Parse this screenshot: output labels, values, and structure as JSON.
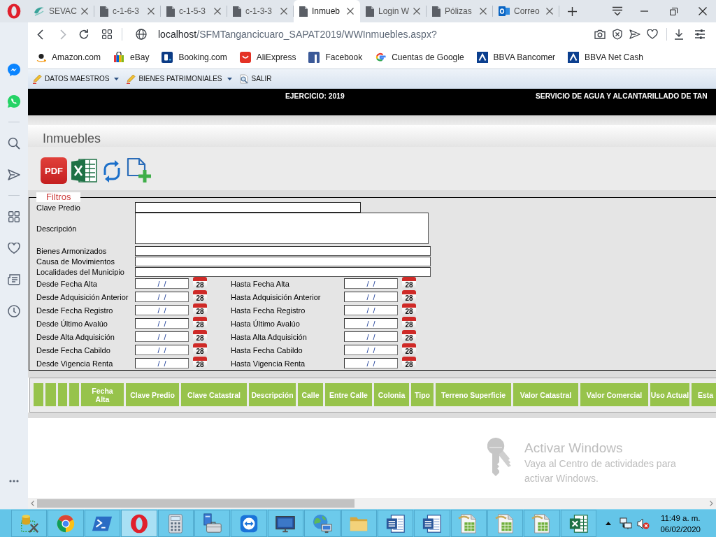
{
  "browser": {
    "tabs": [
      {
        "title": "SEVAC",
        "selected": false
      },
      {
        "title": "c-1-6-3",
        "selected": false
      },
      {
        "title": "c-1-5-3",
        "selected": false
      },
      {
        "title": "c-1-3-3",
        "selected": false
      },
      {
        "title": "Inmueb",
        "selected": true
      },
      {
        "title": "Login W",
        "selected": false
      },
      {
        "title": "Pólizas",
        "selected": false
      },
      {
        "title": "Correo",
        "selected": false
      }
    ],
    "address": {
      "host": "localhost",
      "path": "/SFMTangancicuaro_SAPAT2019/WWInmuebles.aspx?"
    },
    "bookmarks": [
      "Amazon.com",
      "eBay",
      "Booking.com",
      "AliExpress",
      "Facebook",
      "Cuentas de Google",
      "BBVA Bancomer",
      "BBVA Net Cash"
    ]
  },
  "menu": [
    {
      "label": "DATOS MAESTROS",
      "kind": "submenu"
    },
    {
      "label": "BIENES PATRIMONIALES",
      "kind": "submenu"
    },
    {
      "label": "SALIR",
      "kind": "command"
    }
  ],
  "header": {
    "exercise": "EJERCICIO: 2019",
    "organization": "SERVICIO DE AGUA Y ALCANTARILLADO DE TAN"
  },
  "page_title": "Inmuebles",
  "toolbar": [
    {
      "kind": "pdf",
      "label": "PDF"
    },
    {
      "kind": "spreadsheet"
    },
    {
      "kind": "refresh"
    },
    {
      "kind": "add"
    }
  ],
  "filters": {
    "legend": "Filtros",
    "fields": [
      {
        "label": "Clave Predio",
        "kind": "short"
      },
      {
        "label": "Descripción",
        "kind": "multiline"
      },
      {
        "label": "Bienes Armonizados",
        "kind": "long"
      },
      {
        "label": "Causa de Movimientos",
        "kind": "long"
      },
      {
        "label": "Localidades del Municipio",
        "kind": "long"
      }
    ],
    "date_ranges": [
      {
        "from": {
          "label": "Desde Fecha Alta",
          "value": "/  /",
          "calendar": "28"
        },
        "to": {
          "label": "Hasta Fecha Alta",
          "value": "/  /",
          "calendar": "28"
        }
      },
      {
        "from": {
          "label": "Desde Adquisición Anterior",
          "value": "/  /",
          "calendar": "28"
        },
        "to": {
          "label": "Hasta Adquisición Anterior",
          "value": "/  /",
          "calendar": "28"
        }
      },
      {
        "from": {
          "label": "Desde Fecha Registro",
          "value": "/  /",
          "calendar": "28"
        },
        "to": {
          "label": "Hasta Fecha Registro",
          "value": "/  /",
          "calendar": "28"
        }
      },
      {
        "from": {
          "label": "Desde Último Avalúo",
          "value": "/  /",
          "calendar": "28"
        },
        "to": {
          "label": "Hasta Último Avalúo",
          "value": "/  /",
          "calendar": "28"
        }
      },
      {
        "from": {
          "label": "Desde Alta Adquisición",
          "value": "/  /",
          "calendar": "28"
        },
        "to": {
          "label": "Hasta Alta Adquisición",
          "value": "/  /",
          "calendar": "28"
        }
      },
      {
        "from": {
          "label": "Desde Fecha Cabildo",
          "value": "/  /",
          "calendar": "28"
        },
        "to": {
          "label": "Hasta Fecha Cabildo",
          "value": "/  /",
          "calendar": "28"
        }
      },
      {
        "from": {
          "label": "Desde Vigencia Renta",
          "value": "/  /",
          "calendar": "28"
        },
        "to": {
          "label": "Hasta Vigencia Renta",
          "value": "/  /",
          "calendar": "28"
        }
      }
    ]
  },
  "grid": {
    "columns": [
      {
        "kind": "blank"
      },
      {
        "kind": "blank"
      },
      {
        "kind": "blank"
      },
      {
        "kind": "blank"
      },
      {
        "kind": "text",
        "label": "Fecha Alta"
      },
      {
        "kind": "text",
        "label": "Clave Predio"
      },
      {
        "kind": "text",
        "label": "Clave Catastral"
      },
      {
        "kind": "text",
        "label": "Descripción"
      },
      {
        "kind": "text",
        "label": "Calle"
      },
      {
        "kind": "text",
        "label": "Entre Calle"
      },
      {
        "kind": "text",
        "label": "Colonia"
      },
      {
        "kind": "text",
        "label": "Tipo"
      },
      {
        "kind": "text",
        "label": "Terreno Superficie"
      },
      {
        "kind": "text",
        "label": "Valor Catastral"
      },
      {
        "kind": "text",
        "label": "Valor Comercial"
      },
      {
        "kind": "text",
        "label": "Uso Actual"
      },
      {
        "kind": "text",
        "label": "Esta"
      }
    ]
  },
  "activation_notice": {
    "title": "Activar Windows",
    "text": "Vaya al Centro de actividades para activar Windows."
  },
  "taskbar": {
    "apps": [
      {
        "selected": false
      },
      {
        "selected": false
      },
      {
        "selected": false
      },
      {
        "selected": true
      },
      {
        "selected": false
      },
      {
        "selected": false
      },
      {
        "selected": false
      },
      {
        "selected": false
      },
      {
        "selected": false
      },
      {
        "selected": false
      },
      {
        "selected": false
      },
      {
        "selected": false
      },
      {
        "selected": false
      },
      {
        "selected": false
      },
      {
        "selected": false
      },
      {
        "selected": false
      }
    ],
    "clock": {
      "time": "11:49 a. m.",
      "date": "06/02/2020"
    }
  }
}
